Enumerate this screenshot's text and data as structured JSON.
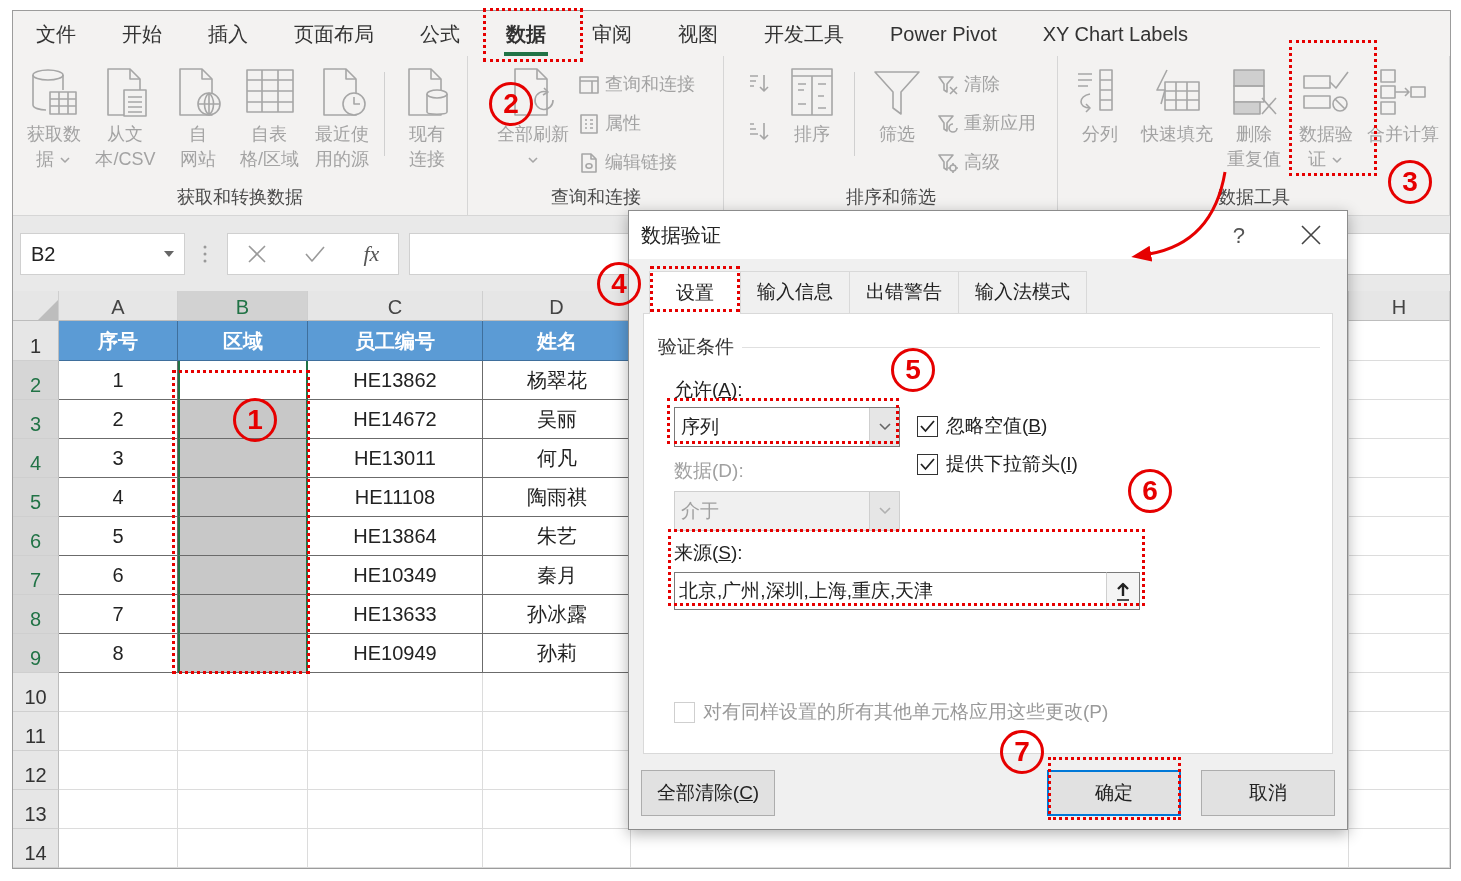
{
  "ribbon_tabs": [
    {
      "label": "文件",
      "selected": false
    },
    {
      "label": "开始",
      "selected": false
    },
    {
      "label": "插入",
      "selected": false
    },
    {
      "label": "页面布局",
      "selected": false
    },
    {
      "label": "公式",
      "selected": false
    },
    {
      "label": "数据",
      "selected": true
    },
    {
      "label": "审阅",
      "selected": false
    },
    {
      "label": "视图",
      "selected": false
    },
    {
      "label": "开发工具",
      "selected": false
    },
    {
      "label": "Power Pivot",
      "selected": false
    },
    {
      "label": "XY Chart Labels",
      "selected": false
    }
  ],
  "ribbon_groups": [
    {
      "label": "获取和转换数据",
      "items": [
        {
          "kind": "large",
          "lines": [
            "获取数",
            "据"
          ],
          "dropdown": true
        },
        {
          "kind": "large",
          "lines": [
            "从文",
            "本/CSV"
          ],
          "dropdown": false
        },
        {
          "kind": "large",
          "lines": [
            "自",
            "网站"
          ],
          "dropdown": false
        },
        {
          "kind": "large",
          "lines": [
            "自表",
            "格/区域"
          ],
          "dropdown": false
        },
        {
          "kind": "large",
          "lines": [
            "最近使",
            "用的源"
          ],
          "dropdown": false
        },
        {
          "kind": "separator"
        },
        {
          "kind": "large",
          "lines": [
            "现有",
            "连接"
          ],
          "dropdown": false
        }
      ]
    },
    {
      "label": "查询和连接",
      "items": [
        {
          "kind": "large",
          "lines": [
            "全部刷新"
          ],
          "dropdown": true
        },
        {
          "kind": "small_stack",
          "entries": [
            "查询和连接",
            "属性",
            "编辑链接"
          ]
        }
      ]
    },
    {
      "label": "排序和筛选",
      "items": [
        {
          "kind": "sort_buttons"
        },
        {
          "kind": "large",
          "lines": [
            "排序"
          ],
          "dropdown": false
        },
        {
          "kind": "separator"
        },
        {
          "kind": "large",
          "lines": [
            "筛选"
          ],
          "dropdown": false
        },
        {
          "kind": "small_stack",
          "entries": [
            "清除",
            "重新应用",
            "高级"
          ]
        }
      ]
    },
    {
      "label": "数据工具",
      "items": [
        {
          "kind": "large",
          "lines": [
            "分列"
          ],
          "dropdown": false
        },
        {
          "kind": "large",
          "lines": [
            "快速填充"
          ],
          "dropdown": false
        },
        {
          "kind": "large",
          "lines": [
            "删除",
            "重复值"
          ],
          "dropdown": false
        },
        {
          "kind": "large",
          "lines": [
            "数据验",
            "证"
          ],
          "dropdown": true
        },
        {
          "kind": "large",
          "lines": [
            "合并计算"
          ],
          "dropdown": false
        }
      ]
    }
  ],
  "formula_bar": {
    "name_box": "B2",
    "function_label": "fx"
  },
  "sheet": {
    "columns": [
      {
        "label": "A",
        "selected": false
      },
      {
        "label": "B",
        "selected": true
      },
      {
        "label": "C",
        "selected": false
      },
      {
        "label": "D",
        "selected": false
      }
    ],
    "far_column": {
      "label": "H",
      "selected": false
    },
    "rows": [
      {
        "number": "1",
        "selected": false,
        "kind": "header",
        "cells": [
          "序号",
          "区域",
          "员工编号",
          "姓名"
        ]
      },
      {
        "number": "2",
        "selected": true,
        "kind": "data",
        "cells": [
          "1",
          null,
          "HE13862",
          "杨翠花"
        ]
      },
      {
        "number": "3",
        "selected": true,
        "kind": "data",
        "cells": [
          "2",
          null,
          "HE14672",
          "吴丽"
        ]
      },
      {
        "number": "4",
        "selected": true,
        "kind": "data",
        "cells": [
          "3",
          null,
          "HE13011",
          "何凡"
        ]
      },
      {
        "number": "5",
        "selected": true,
        "kind": "data",
        "cells": [
          "4",
          null,
          "HE11108",
          "陶雨祺"
        ]
      },
      {
        "number": "6",
        "selected": true,
        "kind": "data",
        "cells": [
          "5",
          null,
          "HE13864",
          "朱艺"
        ]
      },
      {
        "number": "7",
        "selected": true,
        "kind": "data",
        "cells": [
          "6",
          null,
          "HE10349",
          "秦月"
        ]
      },
      {
        "number": "8",
        "selected": true,
        "kind": "data",
        "cells": [
          "7",
          null,
          "HE13633",
          "孙冰露"
        ]
      },
      {
        "number": "9",
        "selected": true,
        "kind": "data",
        "cells": [
          "8",
          null,
          "HE10949",
          "孙莉"
        ]
      },
      {
        "number": "10",
        "selected": false,
        "kind": "empty"
      },
      {
        "number": "11",
        "selected": false,
        "kind": "empty"
      },
      {
        "number": "12",
        "selected": false,
        "kind": "empty"
      },
      {
        "number": "13",
        "selected": false,
        "kind": "empty"
      },
      {
        "number": "14",
        "selected": false,
        "kind": "empty"
      }
    ]
  },
  "dialog": {
    "title": "数据验证",
    "help": "?",
    "tabs": [
      {
        "label": "设置",
        "selected": true
      },
      {
        "label": "输入信息",
        "selected": false
      },
      {
        "label": "出错警告",
        "selected": false
      },
      {
        "label": "输入法模式",
        "selected": false
      }
    ],
    "section_title": "验证条件",
    "allow": {
      "label": [
        "允许(",
        "A",
        "):"
      ],
      "value": "序列",
      "disabled": false
    },
    "data": {
      "label": [
        "数据(D):"
      ],
      "value": "介于",
      "disabled": true
    },
    "checkboxes": [
      {
        "label": [
          "忽略空值(",
          "B",
          ")"
        ],
        "checked": true
      },
      {
        "label": [
          "提供下拉箭头(",
          "I",
          ")"
        ],
        "checked": true
      }
    ],
    "source": {
      "label": [
        "来源(",
        "S",
        "):"
      ],
      "value": "北京,广州,深圳,上海,重庆,天津"
    },
    "apply_all": {
      "label": "对有同样设置的所有其他单元格应用这些更改(P)",
      "checked": false,
      "disabled": true
    },
    "buttons": [
      {
        "label": [
          "全部清除(",
          "C",
          ")"
        ],
        "default": false
      },
      {
        "label": [
          "确定"
        ],
        "default": true
      },
      {
        "label": [
          "取消"
        ],
        "default": false
      }
    ]
  },
  "annotations": [
    {
      "label": "1"
    },
    {
      "label": "2"
    },
    {
      "label": "3"
    },
    {
      "label": "4"
    },
    {
      "label": "5"
    },
    {
      "label": "6"
    },
    {
      "label": "7"
    }
  ]
}
